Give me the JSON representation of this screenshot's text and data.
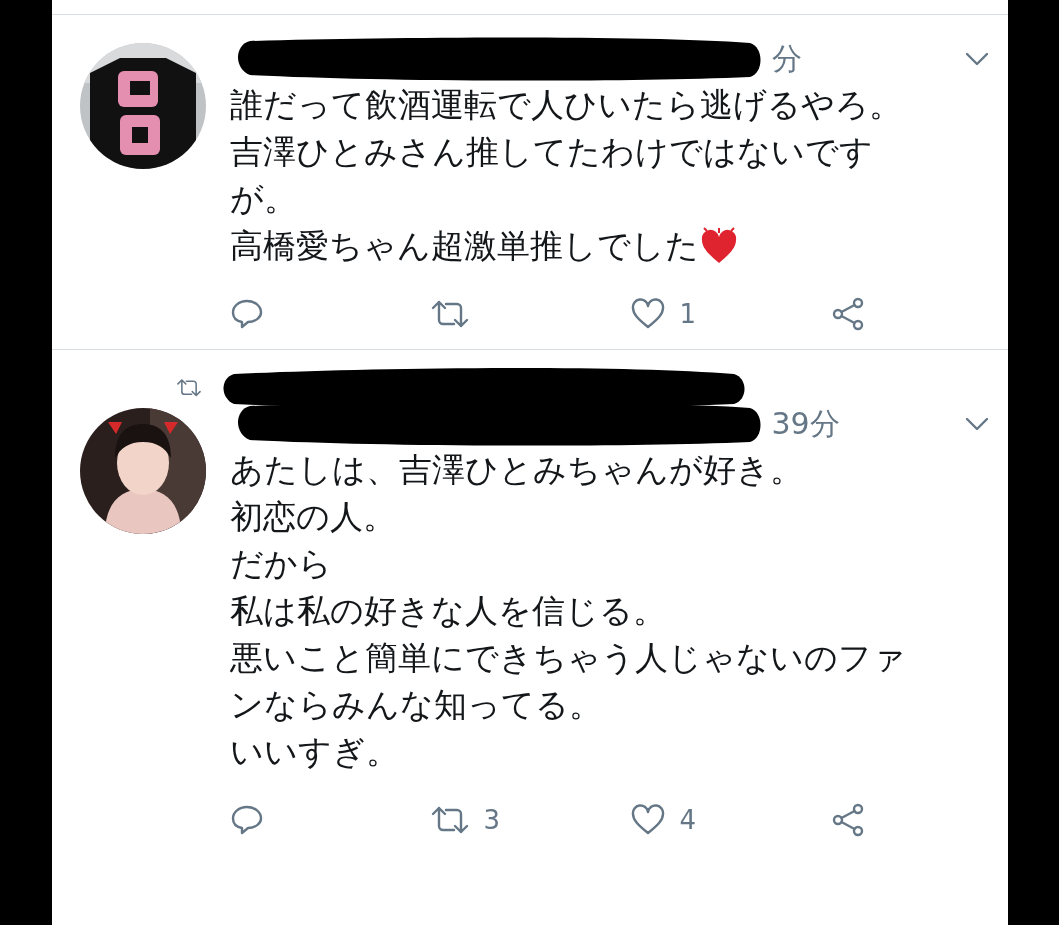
{
  "tweets": [
    {
      "retweeted": false,
      "time": "分",
      "text_lines": [
        "誰だって飲酒運転で人ひいたら逃げるやろ。",
        "吉澤ひとみさん推してたわけではないです",
        "が。",
        "高橋愛ちゃん超激単推しでした"
      ],
      "emoji": {
        "kind": "heart"
      },
      "actions": {
        "like_count": "1"
      }
    },
    {
      "retweeted": true,
      "time": "39分",
      "text_lines": [
        "あたしは、吉澤ひとみちゃんが好き。",
        "初恋の人。",
        "だから",
        "私は私の好きな人を信じる。",
        "悪いこと簡単にできちゃう人じゃないのファ",
        "ンならみんな知ってる。",
        "いいすぎ。"
      ],
      "actions": {
        "retweet_count": "3",
        "like_count": "4"
      }
    }
  ]
}
